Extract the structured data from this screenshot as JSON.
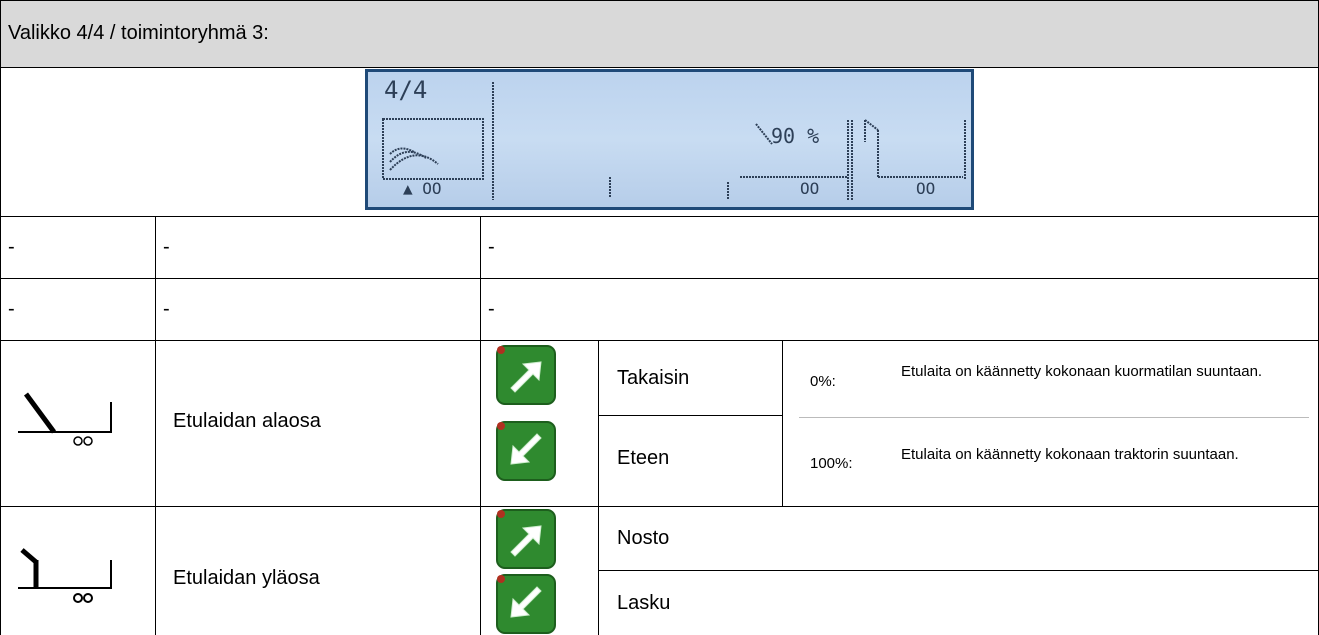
{
  "header": {
    "title": "Valikko 4/4 / toimintoryhmä 3:"
  },
  "display": {
    "page": "4/4",
    "percent": "90 %",
    "wheels_1": "▲ OO",
    "wheels_2": "OO",
    "wheels_3": "OO"
  },
  "rows": [
    {
      "col1": "-",
      "col2": "-",
      "col3": "-"
    },
    {
      "col1": "-",
      "col2": "-",
      "col3": "-"
    }
  ],
  "front_lower": {
    "name": "Etulaidan alaosa",
    "up_label": "Takaisin",
    "down_label": "Eteen",
    "note1_pct": "0%:",
    "note1_text": "Etulaita on käännetty kokonaan kuormatilan suuntaan.",
    "note2_pct": "100%:",
    "note2_text": "Etulaita on käännetty kokonaan traktorin suuntaan.",
    "icon": "front-wall-lower-icon"
  },
  "front_upper": {
    "name": "Etulaidan yläosa",
    "up_label": "Nosto",
    "down_label": "Lasku",
    "icon": "front-wall-upper-icon"
  },
  "colors": {
    "header_bg": "#d9d9d9",
    "lcd_bg": "#c4d9f0",
    "lcd_frame": "#1f4a78",
    "button_green": "#2f8a2f"
  }
}
